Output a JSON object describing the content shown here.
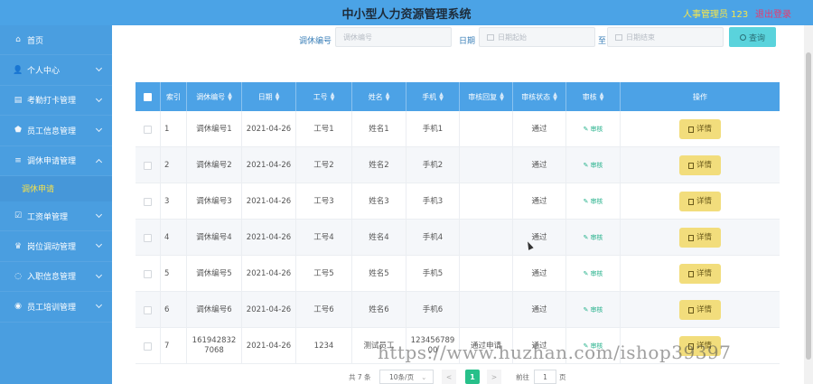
{
  "header": {
    "title": "中小型人力资源管理系统",
    "admin": "人事管理员 123",
    "logout": "退出登录"
  },
  "sidebar": {
    "items": [
      {
        "label": "首页",
        "icon": "home-icon",
        "glyph": "⌂",
        "has_chevron": false
      },
      {
        "label": "个人中心",
        "icon": "user-icon",
        "glyph": "👤",
        "has_chevron": true
      },
      {
        "label": "考勤打卡管理",
        "icon": "clipboard-icon",
        "glyph": "▤",
        "has_chevron": true
      },
      {
        "label": "员工信息管理",
        "icon": "shield-icon",
        "glyph": "⬟",
        "has_chevron": true
      },
      {
        "label": "调休申请管理",
        "icon": "list-icon",
        "glyph": "≡",
        "has_chevron": true,
        "open": true
      }
    ],
    "submenu": {
      "label": "调休申请"
    },
    "items_after": [
      {
        "label": "工资单管理",
        "icon": "check-square-icon",
        "glyph": "☑",
        "has_chevron": true
      },
      {
        "label": "岗位调动管理",
        "icon": "trophy-icon",
        "glyph": "♛",
        "has_chevron": true
      },
      {
        "label": "入职信息管理",
        "icon": "circle-icon",
        "glyph": "◌",
        "has_chevron": true
      },
      {
        "label": "员工培训管理",
        "icon": "circle-check-icon",
        "glyph": "◉",
        "has_chevron": true
      }
    ]
  },
  "search": {
    "code_label": "调休编号",
    "code_placeholder": "调休编号",
    "date_label": "日期",
    "date_start_placeholder": "日期起始",
    "to_label": "至",
    "date_end_placeholder": "日期结束",
    "query_label": "查询"
  },
  "table": {
    "headers": {
      "index": "索引",
      "code": "调休编号",
      "date": "日期",
      "emp_no": "工号",
      "name": "姓名",
      "phone": "手机",
      "reply": "审核回复",
      "status": "审核状态",
      "audit": "审核",
      "action": "操作"
    },
    "audit_link": "审核",
    "detail_label": "详情",
    "rows": [
      {
        "index": "1",
        "code": "调休编号1",
        "date": "2021-04-26",
        "emp_no": "工号1",
        "name": "姓名1",
        "phone": "手机1",
        "reply": "",
        "status": "通过"
      },
      {
        "index": "2",
        "code": "调休编号2",
        "date": "2021-04-26",
        "emp_no": "工号2",
        "name": "姓名2",
        "phone": "手机2",
        "reply": "",
        "status": "通过"
      },
      {
        "index": "3",
        "code": "调休编号3",
        "date": "2021-04-26",
        "emp_no": "工号3",
        "name": "姓名3",
        "phone": "手机3",
        "reply": "",
        "status": "通过"
      },
      {
        "index": "4",
        "code": "调休编号4",
        "date": "2021-04-26",
        "emp_no": "工号4",
        "name": "姓名4",
        "phone": "手机4",
        "reply": "",
        "status": "通过"
      },
      {
        "index": "5",
        "code": "调休编号5",
        "date": "2021-04-26",
        "emp_no": "工号5",
        "name": "姓名5",
        "phone": "手机5",
        "reply": "",
        "status": "通过"
      },
      {
        "index": "6",
        "code": "调休编号6",
        "date": "2021-04-26",
        "emp_no": "工号6",
        "name": "姓名6",
        "phone": "手机6",
        "reply": "",
        "status": "通过"
      },
      {
        "index": "7",
        "code": "1619428327068",
        "date": "2021-04-26",
        "emp_no": "1234",
        "name": "测试员工",
        "phone": "12345678900",
        "reply": "通过申请",
        "status": "通过"
      }
    ]
  },
  "pager": {
    "total": "共 7 条",
    "page_size": "10条/页",
    "prev": "<",
    "current": "1",
    "next": ">",
    "goto_label": "前往",
    "goto_value": "1",
    "page_unit": "页"
  },
  "watermark": "https://www.huzhan.com/ishop39397"
}
